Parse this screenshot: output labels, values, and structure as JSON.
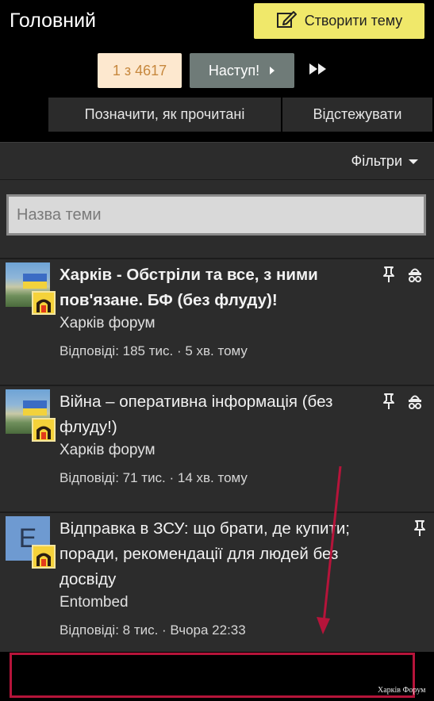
{
  "header": {
    "title": "Головний",
    "create_label": "Створити тему"
  },
  "pagination": {
    "page_label": "1 з 4617",
    "next_label": "Наступ!"
  },
  "actions": {
    "mark_read": "Позначити, як прочитані",
    "watch": "Відстежувати"
  },
  "filters": {
    "label": "Фільтри"
  },
  "search": {
    "placeholder": "Назва теми"
  },
  "threads": [
    {
      "title_line1": "Харків - Обстріли та все, з ними",
      "title_line2": "пов'язане. БФ (без флуду)!",
      "forum": "Харків форум",
      "meta": "Відповіді: 185 тис. · 5 хв. тому"
    },
    {
      "title_line1": "Війна – оперативна інформація (без",
      "title_line2": "флуду!)",
      "forum": "Харків форум",
      "meta": "Відповіді: 71 тис. · 14 хв. тому"
    },
    {
      "avatar_letter": "E",
      "title_line1": "Відправка в ЗСУ: що брати, де купити;",
      "title_line2": "поради, рекомендації для людей без",
      "title_line3": "досвіду",
      "author": "Entombed",
      "meta": "Відповіді: 8 тис. · Вчора 22:33"
    }
  ],
  "watermark": "Харків Форум",
  "colors": {
    "create_button": "#f0e86a",
    "page_badge_bg": "#fde8cf",
    "page_badge_text": "#c7883e",
    "next_button": "#6f7b78",
    "annotation": "#b5143a"
  }
}
